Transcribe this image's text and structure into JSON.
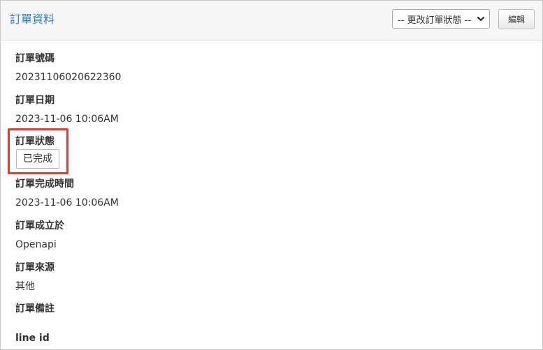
{
  "header": {
    "title": "訂單資料",
    "status_select_value": "-- 更改訂單狀態 --",
    "edit_label": "編輯"
  },
  "fields": {
    "order_number": {
      "label": "訂單號碼",
      "value": "20231106020622360"
    },
    "order_date": {
      "label": "訂單日期",
      "value": "2023-11-06 10:06AM"
    },
    "order_status": {
      "label": "訂單狀態",
      "value": "已完成"
    },
    "completed_time": {
      "label": "訂單完成時間",
      "value": "2023-11-06 10:06AM"
    },
    "created_via": {
      "label": "訂單成立於",
      "value": "Openapi"
    },
    "order_source": {
      "label": "訂單來源",
      "value": "其他"
    },
    "order_notes": {
      "label": "訂單備註",
      "value": ""
    },
    "line_id": {
      "label": "line id",
      "value": ""
    }
  },
  "colors": {
    "title_link": "#2b7cc0",
    "highlight": "#e53935"
  },
  "icons": {
    "select_arrow": "chevron-down-icon"
  }
}
